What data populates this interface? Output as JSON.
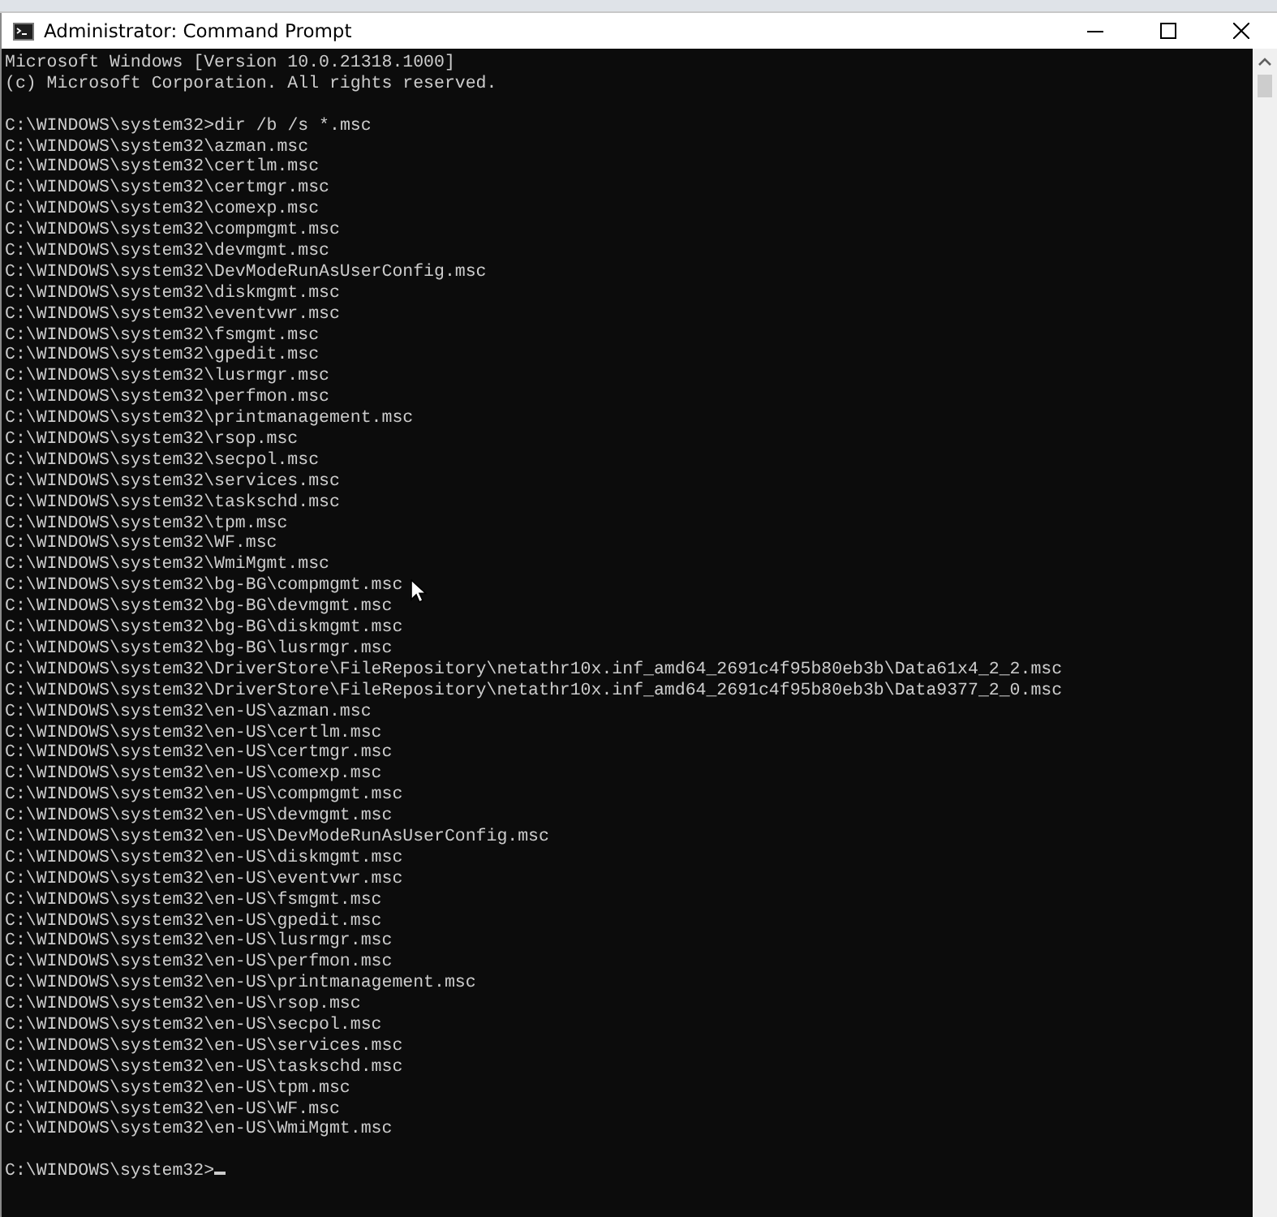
{
  "window": {
    "title": "Administrator: Command Prompt"
  },
  "console": {
    "banner": [
      "Microsoft Windows [Version 10.0.21318.1000]",
      "(c) Microsoft Corporation. All rights reserved."
    ],
    "sessions": [
      {
        "prompt": "C:\\WINDOWS\\system32>",
        "command": "dir /b /s *.msc",
        "output": [
          "C:\\WINDOWS\\system32\\azman.msc",
          "C:\\WINDOWS\\system32\\certlm.msc",
          "C:\\WINDOWS\\system32\\certmgr.msc",
          "C:\\WINDOWS\\system32\\comexp.msc",
          "C:\\WINDOWS\\system32\\compmgmt.msc",
          "C:\\WINDOWS\\system32\\devmgmt.msc",
          "C:\\WINDOWS\\system32\\DevModeRunAsUserConfig.msc",
          "C:\\WINDOWS\\system32\\diskmgmt.msc",
          "C:\\WINDOWS\\system32\\eventvwr.msc",
          "C:\\WINDOWS\\system32\\fsmgmt.msc",
          "C:\\WINDOWS\\system32\\gpedit.msc",
          "C:\\WINDOWS\\system32\\lusrmgr.msc",
          "C:\\WINDOWS\\system32\\perfmon.msc",
          "C:\\WINDOWS\\system32\\printmanagement.msc",
          "C:\\WINDOWS\\system32\\rsop.msc",
          "C:\\WINDOWS\\system32\\secpol.msc",
          "C:\\WINDOWS\\system32\\services.msc",
          "C:\\WINDOWS\\system32\\taskschd.msc",
          "C:\\WINDOWS\\system32\\tpm.msc",
          "C:\\WINDOWS\\system32\\WF.msc",
          "C:\\WINDOWS\\system32\\WmiMgmt.msc",
          "C:\\WINDOWS\\system32\\bg-BG\\compmgmt.msc",
          "C:\\WINDOWS\\system32\\bg-BG\\devmgmt.msc",
          "C:\\WINDOWS\\system32\\bg-BG\\diskmgmt.msc",
          "C:\\WINDOWS\\system32\\bg-BG\\lusrmgr.msc",
          "C:\\WINDOWS\\system32\\DriverStore\\FileRepository\\netathr10x.inf_amd64_2691c4f95b80eb3b\\Data61x4_2_2.msc",
          "C:\\WINDOWS\\system32\\DriverStore\\FileRepository\\netathr10x.inf_amd64_2691c4f95b80eb3b\\Data9377_2_0.msc",
          "C:\\WINDOWS\\system32\\en-US\\azman.msc",
          "C:\\WINDOWS\\system32\\en-US\\certlm.msc",
          "C:\\WINDOWS\\system32\\en-US\\certmgr.msc",
          "C:\\WINDOWS\\system32\\en-US\\comexp.msc",
          "C:\\WINDOWS\\system32\\en-US\\compmgmt.msc",
          "C:\\WINDOWS\\system32\\en-US\\devmgmt.msc",
          "C:\\WINDOWS\\system32\\en-US\\DevModeRunAsUserConfig.msc",
          "C:\\WINDOWS\\system32\\en-US\\diskmgmt.msc",
          "C:\\WINDOWS\\system32\\en-US\\eventvwr.msc",
          "C:\\WINDOWS\\system32\\en-US\\fsmgmt.msc",
          "C:\\WINDOWS\\system32\\en-US\\gpedit.msc",
          "C:\\WINDOWS\\system32\\en-US\\lusrmgr.msc",
          "C:\\WINDOWS\\system32\\en-US\\perfmon.msc",
          "C:\\WINDOWS\\system32\\en-US\\printmanagement.msc",
          "C:\\WINDOWS\\system32\\en-US\\rsop.msc",
          "C:\\WINDOWS\\system32\\en-US\\secpol.msc",
          "C:\\WINDOWS\\system32\\en-US\\services.msc",
          "C:\\WINDOWS\\system32\\en-US\\taskschd.msc",
          "C:\\WINDOWS\\system32\\en-US\\tpm.msc",
          "C:\\WINDOWS\\system32\\en-US\\WF.msc",
          "C:\\WINDOWS\\system32\\en-US\\WmiMgmt.msc"
        ]
      },
      {
        "prompt": "C:\\WINDOWS\\system32>",
        "cursor": true
      }
    ]
  }
}
